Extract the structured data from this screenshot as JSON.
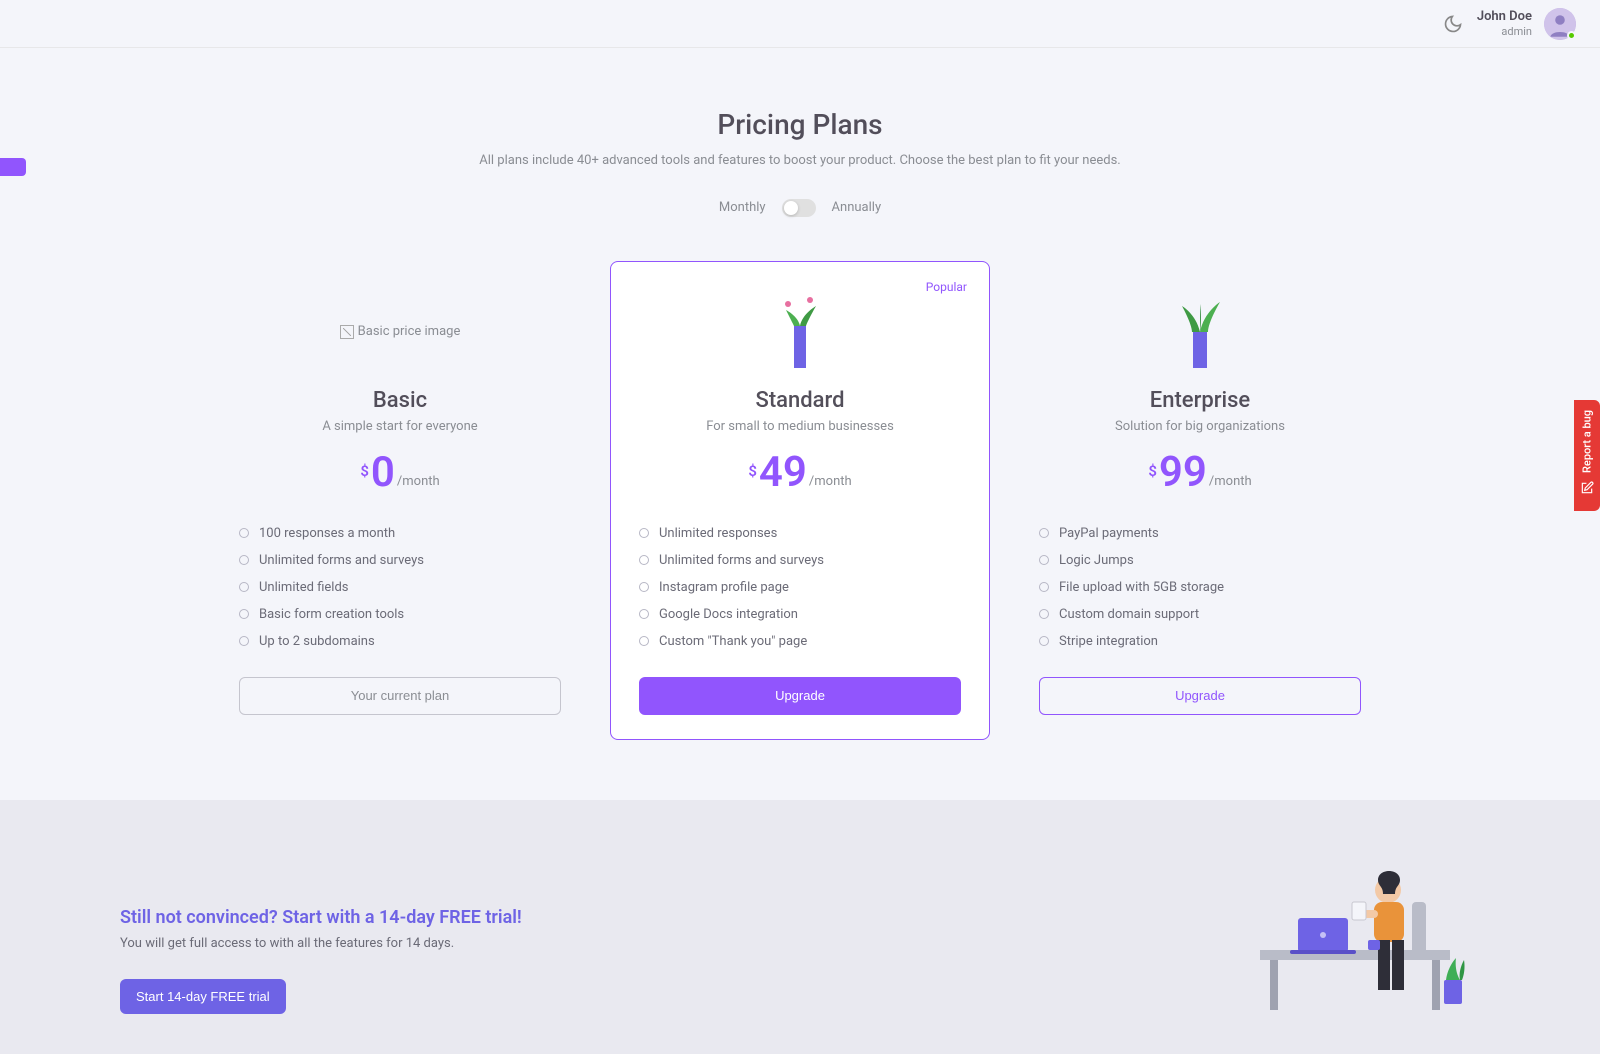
{
  "header": {
    "user_name": "John Doe",
    "user_role": "admin"
  },
  "page": {
    "title": "Pricing Plans",
    "subtitle": "All plans include 40+ advanced tools and features to boost your product. Choose the best plan to fit your needs."
  },
  "toggle": {
    "monthly": "Monthly",
    "annually": "Annually"
  },
  "plans": [
    {
      "name": "Basic",
      "desc": "A simple start for everyone",
      "price": "0",
      "period": "/month",
      "currency": "$",
      "img_alt": "Basic price image",
      "popular": false,
      "features": [
        "100 responses a month",
        "Unlimited forms and surveys",
        "Unlimited fields",
        "Basic form creation tools",
        "Up to 2 subdomains"
      ],
      "button": "Your current plan",
      "button_style": "outline-gray"
    },
    {
      "name": "Standard",
      "desc": "For small to medium businesses",
      "price": "49",
      "period": "/month",
      "currency": "$",
      "popular": true,
      "popular_label": "Popular",
      "features": [
        "Unlimited responses",
        "Unlimited forms and surveys",
        "Instagram profile page",
        "Google Docs integration",
        "Custom \"Thank you\" page"
      ],
      "button": "Upgrade",
      "button_style": "solid-primary"
    },
    {
      "name": "Enterprise",
      "desc": "Solution for big organizations",
      "price": "99",
      "period": "/month",
      "currency": "$",
      "popular": false,
      "features": [
        "PayPal payments",
        "Logic Jumps",
        "File upload with 5GB storage",
        "Custom domain support",
        "Stripe integration"
      ],
      "button": "Upgrade",
      "button_style": "outline-primary"
    }
  ],
  "trial": {
    "title": "Still not convinced? Start with a 14-day FREE trial!",
    "subtitle": "You will get full access to with all the features for 14 days.",
    "button": "Start 14-day FREE trial"
  },
  "sidebar": {
    "report_bug": "Report a bug"
  }
}
